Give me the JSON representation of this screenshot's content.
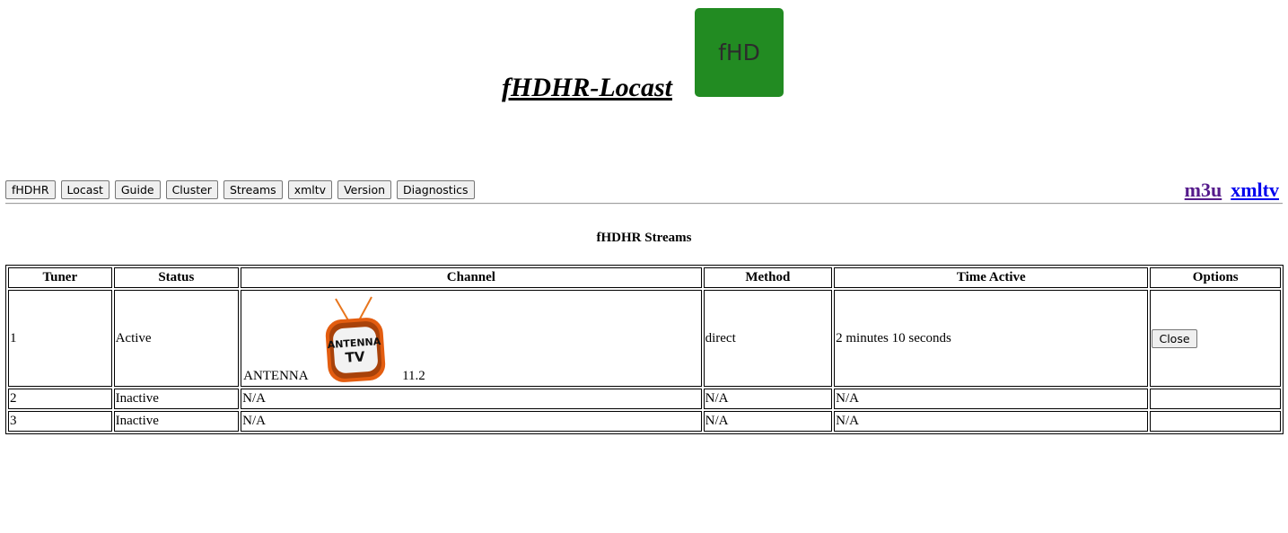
{
  "header": {
    "title": "fHDHR-Locast ",
    "logo_text": "fHD",
    "logo_color": "#228b22"
  },
  "nav": {
    "buttons": [
      "fHDHR",
      "Locast",
      "Guide",
      "Cluster",
      "Streams",
      "xmltv",
      "Version",
      "Diagnostics"
    ]
  },
  "links": {
    "m3u": "m3u",
    "xmltv": "xmltv"
  },
  "section_title": "fHDHR Streams",
  "table": {
    "headers": [
      "Tuner",
      "Status",
      "Channel",
      "Method",
      "Time Active",
      "Options"
    ],
    "rows": [
      {
        "tuner": "1",
        "status": "Active",
        "channel_name": "ANTENNA",
        "channel_number": "11.2",
        "channel_logo": "antenna-tv-logo",
        "method": "direct",
        "time_active": "2 minutes 10 seconds",
        "option_label": "Close"
      },
      {
        "tuner": "2",
        "status": "Inactive",
        "channel": "N/A",
        "method": "N/A",
        "time_active": "N/A"
      },
      {
        "tuner": "3",
        "status": "Inactive",
        "channel": "N/A",
        "method": "N/A",
        "time_active": "N/A"
      }
    ]
  },
  "logo_lettering": [
    "ANTENNA",
    "TV"
  ]
}
